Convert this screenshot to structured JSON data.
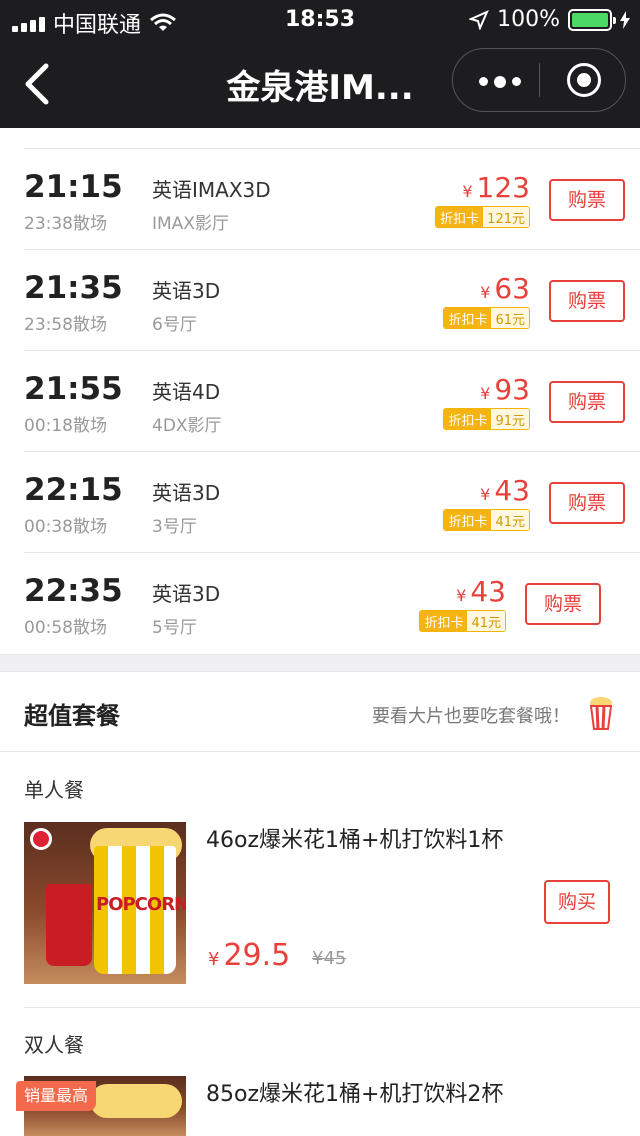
{
  "status_bar": {
    "carrier": "中国联通",
    "time": "18:53",
    "battery": "100%"
  },
  "nav": {
    "title": "金泉港IM..."
  },
  "showtimes": [
    {
      "start": "21:15",
      "end": "23:38散场",
      "lang": "英语IMAX3D",
      "hall": "IMAX影厅",
      "price": "123",
      "card_label": "折扣卡",
      "card_price": "121元",
      "buy": "购票"
    },
    {
      "start": "21:35",
      "end": "23:58散场",
      "lang": "英语3D",
      "hall": "6号厅",
      "price": "63",
      "card_label": "折扣卡",
      "card_price": "61元",
      "buy": "购票"
    },
    {
      "start": "21:55",
      "end": "00:18散场",
      "lang": "英语4D",
      "hall": "4DX影厅",
      "price": "93",
      "card_label": "折扣卡",
      "card_price": "91元",
      "buy": "购票"
    },
    {
      "start": "22:15",
      "end": "00:38散场",
      "lang": "英语3D",
      "hall": "3号厅",
      "price": "43",
      "card_label": "折扣卡",
      "card_price": "41元",
      "buy": "购票"
    },
    {
      "start": "22:35",
      "end": "00:58散场",
      "lang": "英语3D",
      "hall": "5号厅",
      "price": "43",
      "card_label": "折扣卡",
      "card_price": "41元",
      "buy": "购票"
    }
  ],
  "currency": "¥",
  "combo": {
    "title": "超值套餐",
    "tip": "要看大片也要吃套餐哦！",
    "groups": [
      {
        "label": "单人餐",
        "product": {
          "name": "46oz爆米花1桶+机打饮料1杯",
          "price": "29.5",
          "original": "¥45",
          "buy": "购买",
          "image_text": "POPCORN"
        }
      },
      {
        "label": "双人餐",
        "badge": "销量最高",
        "product": {
          "name": "85oz爆米花1桶+机打饮料2杯"
        }
      }
    ]
  },
  "colors": {
    "accent": "#e8403b",
    "nav_bg": "#1d1d20",
    "card_gold": "#f6b414"
  }
}
